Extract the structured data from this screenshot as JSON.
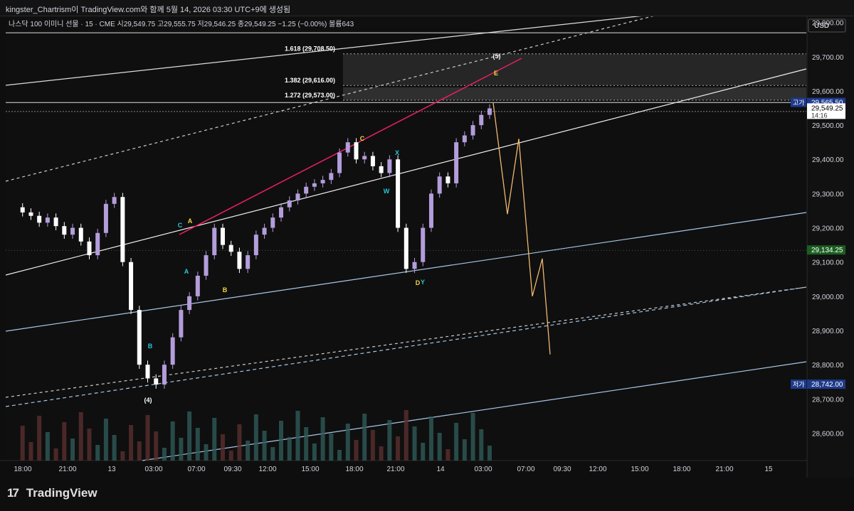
{
  "header": {
    "title": "kingster_Chartrism이 TradingView.com와 함께 5월 14, 2026 03:30 UTC+9에 생성됨"
  },
  "chart_data": {
    "type": "candlestick",
    "symbol_line": "나스닥 100 이미니 선물 · 15 · CME  시29,549.75  고29,555.75  저29,546.25  종29,549.25  −1.25 (−0.00%)  볼륨643",
    "currency": "USD",
    "ylim": [
      28520,
      29820
    ],
    "y_ticks": [
      "29,800.00",
      "29,700.00",
      "29,600.00",
      "29,500.00",
      "29,400.00",
      "29,300.00",
      "29,200.00",
      "29,100.00",
      "29,000.00",
      "28,900.00",
      "28,800.00",
      "28,700.00",
      "28,600.00"
    ],
    "y_tick_values": [
      29800,
      29700,
      29600,
      29500,
      29400,
      29300,
      29200,
      29100,
      29000,
      28900,
      28800,
      28700,
      28600
    ],
    "x_ticks": [
      "18:00",
      "21:00",
      "13",
      "03:00",
      "07:00",
      "09:30",
      "12:00",
      "15:00",
      "18:00",
      "21:00",
      "14",
      "03:00",
      "07:00",
      "09:30",
      "12:00",
      "15:00",
      "18:00",
      "21:00",
      "15"
    ],
    "price_labels": [
      {
        "text": "고가",
        "value": "29,565.50",
        "price": 29565.5,
        "color": "#1e3a8a"
      },
      {
        "text": "",
        "value": "29,549.25",
        "sub": "14:16",
        "price": 29549.25,
        "color": "#ffffff"
      },
      {
        "text": "",
        "value": "29,134.25",
        "price": 29134.25,
        "color": "#1b5e20"
      },
      {
        "text": "저가",
        "value": "28,742.00",
        "price": 28742,
        "color": "#1e3a8a"
      }
    ],
    "fib_levels": [
      {
        "label": "1.618 (29,708.50)",
        "price": 29708.5
      },
      {
        "label": "1.382 (29,616.00)",
        "price": 29616
      },
      {
        "label": "1.272 (29,573.00)",
        "price": 29573
      }
    ],
    "price_path": [
      29260,
      29245,
      29235,
      29215,
      29230,
      29205,
      29180,
      29200,
      29160,
      29120,
      29185,
      29270,
      29290,
      29100,
      28960,
      28800,
      28760,
      28742,
      28800,
      28880,
      28960,
      29000,
      29060,
      29120,
      29200,
      29150,
      29130,
      29080,
      29120,
      29180,
      29200,
      29230,
      29260,
      29280,
      29300,
      29320,
      29330,
      29340,
      29360,
      29420,
      29450,
      29400,
      29410,
      29380,
      29360,
      29400,
      29200,
      29080,
      29100,
      29200,
      29300,
      29350,
      29330,
      29450,
      29470,
      29500,
      29530,
      29549
    ],
    "projection": [
      29565,
      29240,
      29460,
      29000,
      29110,
      28830
    ],
    "wave_labels": [
      {
        "text": "(4)",
        "color": "#ffffff"
      },
      {
        "text": "(5)",
        "color": "#ffffff"
      },
      {
        "text": "A",
        "color": "#f5d742"
      },
      {
        "text": "C",
        "color": "#f5d742"
      },
      {
        "text": "B",
        "color": "#f5d742"
      },
      {
        "text": "D",
        "color": "#f5d742"
      },
      {
        "text": "E",
        "color": "#f5d742"
      },
      {
        "text": "A",
        "color": "#26c6da"
      },
      {
        "text": "B",
        "color": "#26c6da"
      },
      {
        "text": "C",
        "color": "#26c6da"
      },
      {
        "text": "W",
        "color": "#26c6da"
      },
      {
        "text": "X",
        "color": "#26c6da"
      },
      {
        "text": "Y",
        "color": "#26c6da"
      }
    ],
    "colors": {
      "up": "#b39ddb",
      "down": "#ffffff",
      "wave": "#26c6da",
      "red_line": "#e91e63",
      "projection": "#f0b870",
      "channel": "#ffffff",
      "channel_blue": "#a8c7e8"
    }
  },
  "footer": {
    "brand": "TradingView"
  }
}
